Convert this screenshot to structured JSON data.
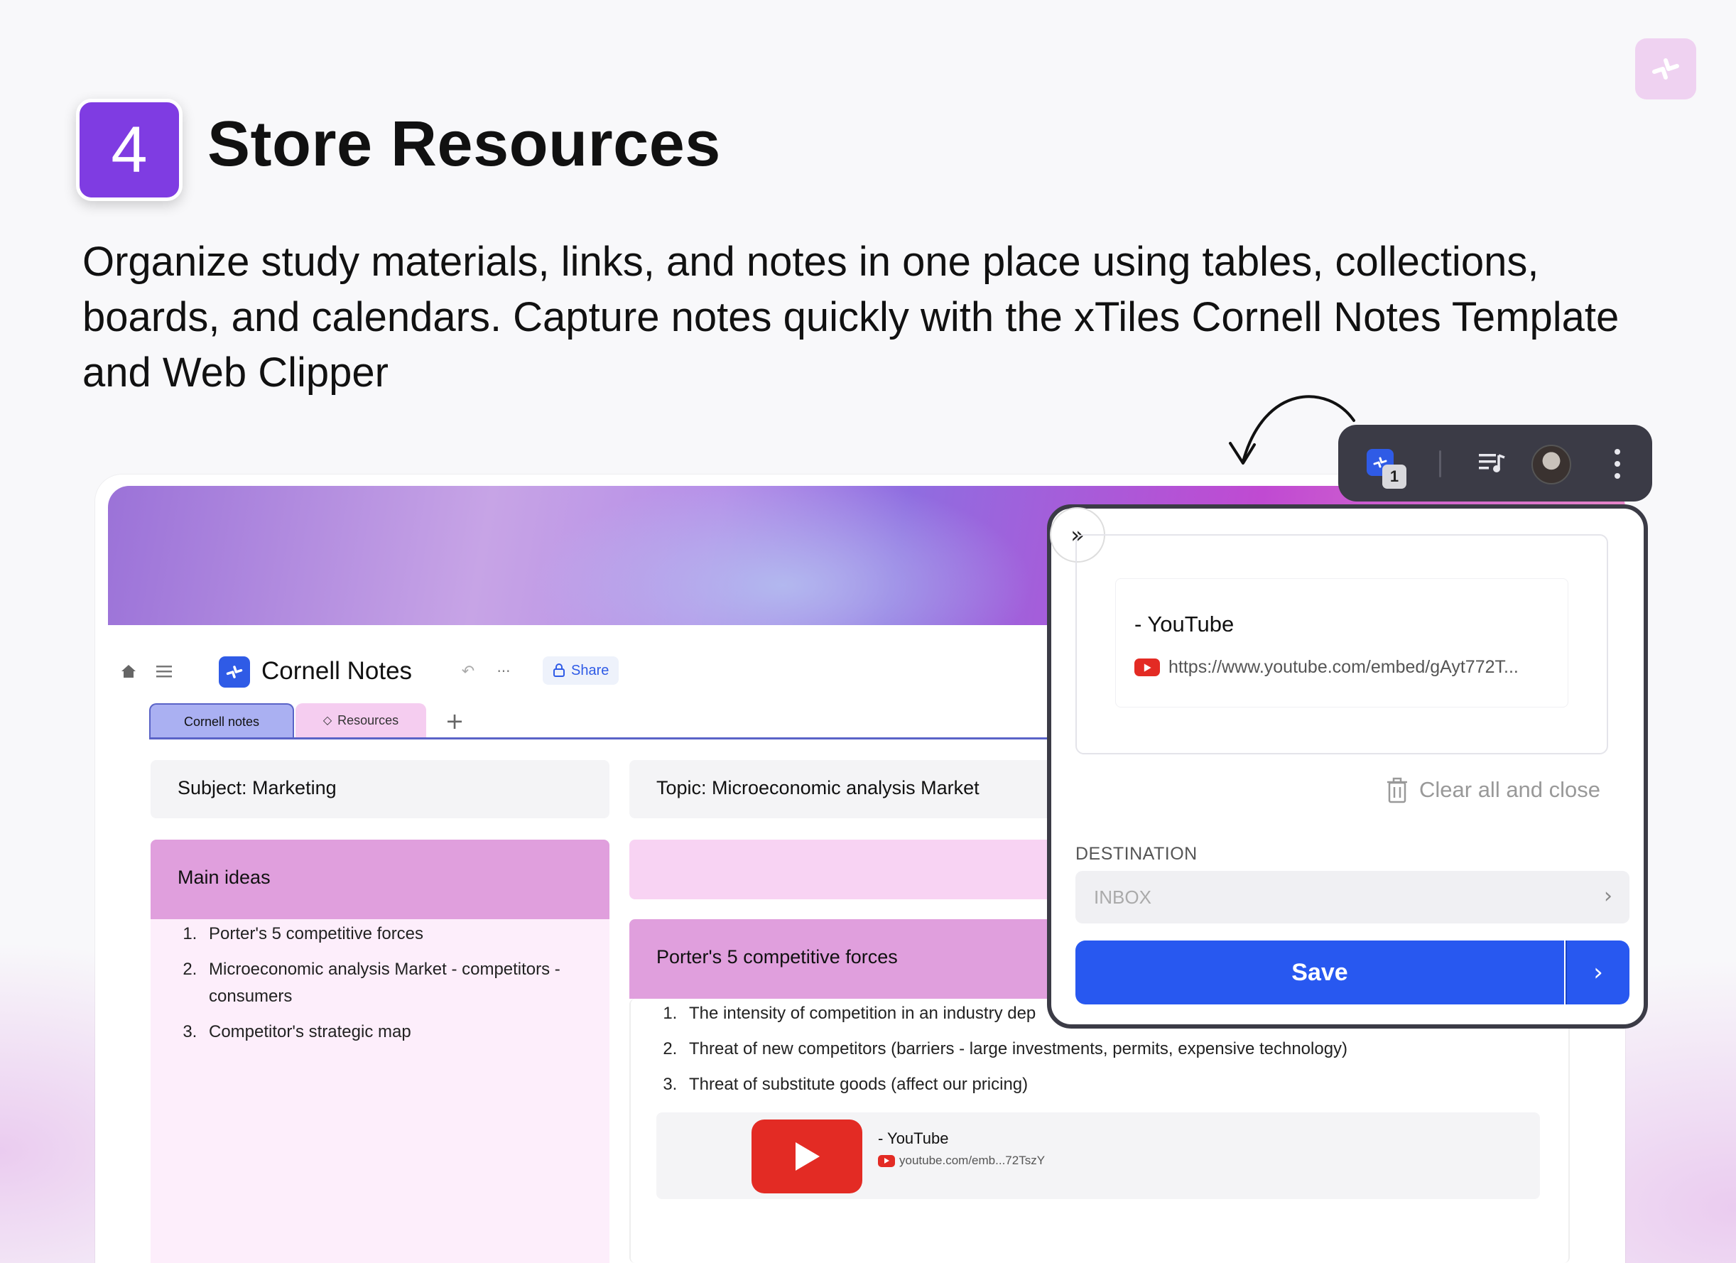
{
  "header": {
    "step_number": "4",
    "title": "Store Resources",
    "description": "Organize study materials, links, and notes in one place using tables, collections, boards, and calendars. Capture notes quickly with the xTiles Cornell Notes Template and Web Clipper"
  },
  "app": {
    "doc_title": "Cornell Notes",
    "share_label": "Share",
    "tabs": [
      {
        "label": "Cornell notes",
        "active": true
      },
      {
        "label": "Resources",
        "active": false
      }
    ],
    "subject": "Subject: Marketing",
    "topic": "Topic: Microeconomic analysis Market",
    "main_ideas": {
      "title": "Main ideas",
      "items": [
        "Porter's 5 competitive forces",
        "Microeconomic analysis Market - competitors - consumers",
        "Competitor's strategic map"
      ]
    },
    "porter": {
      "title": "Porter's 5 competitive forces",
      "items": [
        "The intensity of competition in an industry dep",
        "Threat of new competitors (barriers - large investments, permits, expensive technology)",
        "Threat of substitute goods (affect our pricing)"
      ]
    },
    "embed": {
      "title": "- YouTube",
      "url": "youtube.com/emb...72TszY"
    }
  },
  "extension": {
    "badge_count": "1"
  },
  "clipper": {
    "preview_title": "- YouTube",
    "preview_url": "https://www.youtube.com/embed/gAyt772T...",
    "clear_label": "Clear all and close",
    "destination_label": "DESTINATION",
    "destination_value": "INBOX",
    "save_label": "Save"
  },
  "colors": {
    "accent_purple": "#7f3ce2",
    "brand_blue": "#2858f0",
    "card_pink": "#e09fdd",
    "youtube_red": "#e32b24"
  },
  "icons": [
    "xtiles-logo-icon",
    "home-icon",
    "menu-icon",
    "undo-icon",
    "more-icon",
    "lock-icon",
    "plus-icon",
    "diamond-icon",
    "play-icon",
    "youtube-icon",
    "queue-icon",
    "avatar",
    "more-vertical-icon",
    "double-chevron-right-icon",
    "trash-icon",
    "chevron-right-icon"
  ]
}
